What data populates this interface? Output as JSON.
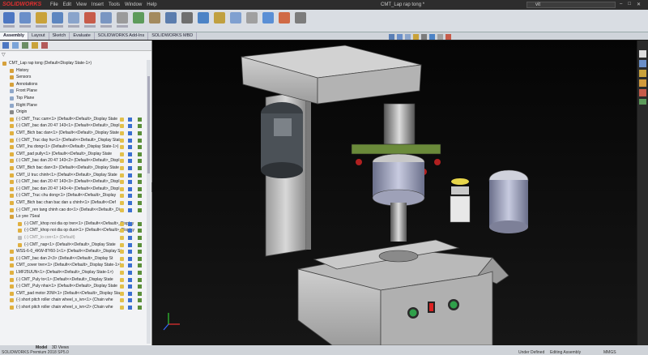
{
  "app": {
    "brand": "SOLIDWORKS",
    "document_title": "CMT_Lap rap tong *"
  },
  "menu": [
    "File",
    "Edit",
    "View",
    "Insert",
    "Tools",
    "Window",
    "Help"
  ],
  "search": {
    "value": "vit"
  },
  "command_tabs": [
    "Assembly",
    "Layout",
    "Sketch",
    "Evaluate",
    "SOLIDWORKS Add-Ins",
    "SOLIDWORKS MBD"
  ],
  "tree": {
    "root": "CMT_Lap rap tong  (Default<Display State-1>)",
    "items": [
      {
        "label": "History",
        "indent": 1,
        "kind": "folder"
      },
      {
        "label": "Sensors",
        "indent": 1,
        "kind": "folder"
      },
      {
        "label": "Annotations",
        "indent": 1,
        "kind": "folder"
      },
      {
        "label": "Front Plane",
        "indent": 1,
        "kind": "plane"
      },
      {
        "label": "Top Plane",
        "indent": 1,
        "kind": "plane"
      },
      {
        "label": "Right Plane",
        "indent": 1,
        "kind": "plane"
      },
      {
        "label": "Origin",
        "indent": 1,
        "kind": "origin"
      },
      {
        "label": "(-) CMT_Truc cam<1> (Default<<Default>_Display State",
        "indent": 1,
        "kind": "part"
      },
      {
        "label": "(-) CMT_bac dan 20 47 143<1> (Default<<Default>_Displ",
        "indent": 1,
        "kind": "part"
      },
      {
        "label": "CMT_Bich bac dan<1> (Default<<Default>_Display State",
        "indent": 1,
        "kind": "part"
      },
      {
        "label": "(-) CMT_Truc day hu<1> (Default<<Default>_Display State",
        "indent": 1,
        "kind": "part"
      },
      {
        "label": "CMT_Inu dong<1> (Default<<Default>_Display State-1>)",
        "indent": 1,
        "kind": "part"
      },
      {
        "label": "CMT_pad pully<1> (Default<<Default>_Display State",
        "indent": 1,
        "kind": "part"
      },
      {
        "label": "(-) CMT_bac dan 20 47 143<2> (Default<<Default>_Displ",
        "indent": 1,
        "kind": "part"
      },
      {
        "label": "CMT_Bich bac dan<3> (Default<<Default>_Display State",
        "indent": 1,
        "kind": "part"
      },
      {
        "label": "CMT_U truc chinh<1> (Default<<Default>_Display State",
        "indent": 1,
        "kind": "part"
      },
      {
        "label": "(-) CMT_bac dan 20 47 143<3> (Default<<Default>_Displ",
        "indent": 1,
        "kind": "part"
      },
      {
        "label": "(-) CMT_bac dan 20 47 143<4> (Default<<Default>_Displ",
        "indent": 1,
        "kind": "part"
      },
      {
        "label": "(-) CMT_Truc chu dong<1> (Default<<Default>_Display",
        "indent": 1,
        "kind": "part"
      },
      {
        "label": "CMT_Bich bac chan bac dan u chinh<1> (Default<<Def",
        "indent": 1,
        "kind": "part"
      },
      {
        "label": "(-) CMT_ren tang chinh cao do<1> (Default<<Default>_Di",
        "indent": 1,
        "kind": "part"
      },
      {
        "label": "Lo yee 7Seal",
        "indent": 1,
        "kind": "asm"
      },
      {
        "label": "(-) CMT_khop noi dia op tren<1> (Default<<Default>_Display",
        "indent": 2,
        "kind": "part"
      },
      {
        "label": "(-) CMT_khop noi dia op duoi<1> (Default<<Default>_Display",
        "indent": 2,
        "kind": "part"
      },
      {
        "label": "(-) CMT_lo con<1> (Default)",
        "indent": 2,
        "kind": "part-gray"
      },
      {
        "label": "(-) CMT_nap<1> (Default<<Default>_Display State",
        "indent": 2,
        "kind": "part"
      },
      {
        "label": "WSS-6-0_4KW-8?/60-1<1> (Default<<Default>_Display St",
        "indent": 1,
        "kind": "part"
      },
      {
        "label": "(-) CMT_bac dan 2<3> (Default<<Default>_Display St",
        "indent": 1,
        "kind": "part"
      },
      {
        "label": "CMT_cover tren<1> (Default<<Default>_Display State-1>)",
        "indent": 1,
        "kind": "part"
      },
      {
        "label": "LMF25UUN<1> (Default<<Default>_Display State-1>)",
        "indent": 1,
        "kind": "part"
      },
      {
        "label": "(-) CMT_Puly to<1> (Default<<Default>_Display State",
        "indent": 1,
        "kind": "part"
      },
      {
        "label": "(-) CMT_Puly nhai<1> (Default<<Default>_Display State",
        "indent": 1,
        "kind": "part"
      },
      {
        "label": "CMT_pad motor 20W<1> (Default<<Default>_Display Sta",
        "indent": 1,
        "kind": "part"
      },
      {
        "label": "(-) short pitch roller chain wheel_s_ivn<1> (Chain whe",
        "indent": 1,
        "kind": "part"
      },
      {
        "label": "(-) short pitch roller chain wheel_s_ivn<2> (Chain whe",
        "indent": 1,
        "kind": "part"
      }
    ]
  },
  "bottom_tabs": [
    "Model",
    "3D Views"
  ],
  "status": {
    "app": "SOLIDWORKS Premium 2018 SP5.0",
    "state1": "Under Defined",
    "state2": "Editing Assembly",
    "units": "MMGS"
  },
  "colors": {
    "accent": "#e03030",
    "viewport_bg": "#0a0a0a"
  }
}
